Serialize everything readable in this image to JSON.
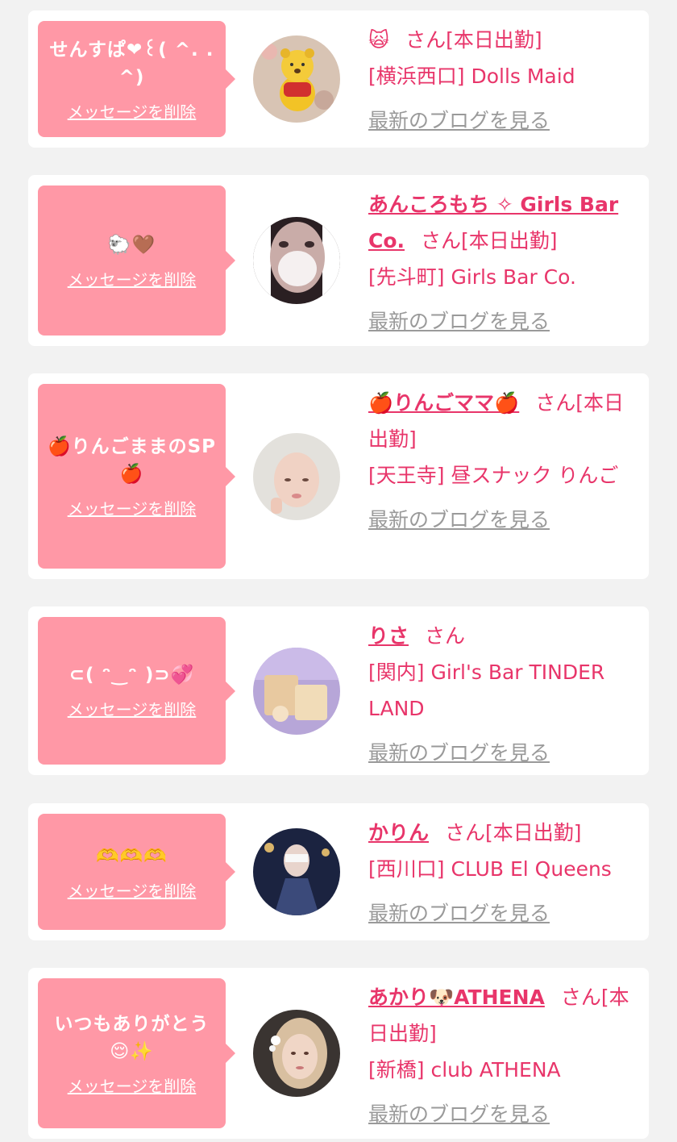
{
  "cards": [
    {
      "message": "せんすぱ❤︎꒰( ^. .^)",
      "delete_label": "メッセージを削除",
      "name": "🙀",
      "honorific": "さん[本日出勤]",
      "store": "[横浜西口] Dolls Maid",
      "blog_label": "最新のブログを見る",
      "avatar": "pooh-plush-avatar"
    },
    {
      "message": "🐑🤎",
      "delete_label": "メッセージを削除",
      "name": "あんころもち ✧ Girls Bar Co.",
      "honorific": "さん[本日出勤]",
      "store": "[先斗町] Girls Bar Co.",
      "blog_label": "最新のブログを見る",
      "avatar": "blurred-face-avatar"
    },
    {
      "message": "🍎りんごままのSP🍎",
      "delete_label": "メッセージを削除",
      "name": "🍎りんごママ🍎",
      "honorific": "さん[本日出勤]",
      "store": "[天王寺] 昼スナック りんご",
      "blog_label": "最新のブログを見る",
      "avatar": "bald-portrait-avatar"
    },
    {
      "message": "⊂( ᵔ‿ᵔ )⊃💞",
      "delete_label": "メッセージを削除",
      "name": "りさ",
      "honorific": "さん",
      "store": "[関内] Girl's Bar TINDER LAND",
      "blog_label": "最新のブログを見る",
      "avatar": "purple-room-avatar"
    },
    {
      "message": "🫶🫶🫶",
      "delete_label": "メッセージを削除",
      "name": "かりん",
      "honorific": "さん[本日出勤]",
      "store": "[西川口] CLUB El Queens",
      "blog_label": "最新のブログを見る",
      "avatar": "dark-dress-avatar"
    },
    {
      "message": "いつもありがとう😌✨",
      "delete_label": "メッセージを削除",
      "name": "あかり🐶ATHENA",
      "honorific": "さん[本日出勤]",
      "store": "[新橋] club ATHENA",
      "blog_label": "最新のブログを見る",
      "avatar": "blonde-portrait-avatar"
    }
  ]
}
